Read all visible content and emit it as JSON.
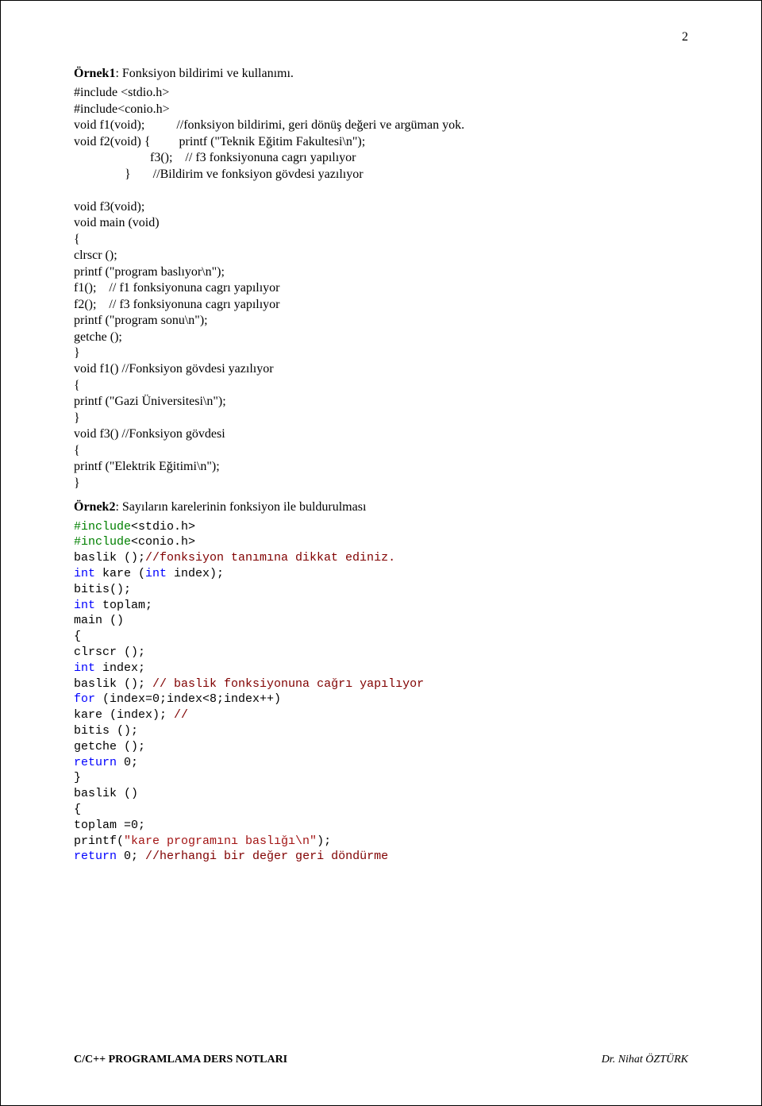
{
  "pageNumber": "2",
  "section1": {
    "title_bold": "Örnek1",
    "title_rest": ": Fonksiyon bildirimi ve kullanımı.",
    "code": "#include <stdio.h>\n#include<conio.h>\nvoid f1(void);          //fonksiyon bildirimi, geri dönüş değeri ve argüman yok.\nvoid f2(void) {         printf (\"Teknik Eğitim Fakultesi\\n\");\n                        f3();    // f3 fonksiyonuna cagrı yapılıyor\n                }       //Bildirim ve fonksiyon gövdesi yazılıyor\n\nvoid f3(void);\nvoid main (void)\n{\nclrscr ();\nprintf (\"program baslıyor\\n\");\nf1();    // f1 fonksiyonuna cagrı yapılıyor\nf2();    // f3 fonksiyonuna cagrı yapılıyor\nprintf (\"program sonu\\n\");\ngetche ();\n}\nvoid f1() //Fonksiyon gövdesi yazılıyor\n{\nprintf (\"Gazi Üniversitesi\\n\");\n}\nvoid f3() //Fonksiyon gövdesi\n{\nprintf (\"Elektrik Eğitimi\\n\");\n}"
  },
  "section2": {
    "title_bold": "Örnek2",
    "title_rest": ": Sayıların karelerinin fonksiyon ile buldurulması",
    "lines": [
      {
        "seg": [
          {
            "c": "k",
            "t": "#include"
          },
          {
            "c": "",
            "t": "<stdio.h>"
          }
        ]
      },
      {
        "seg": [
          {
            "c": "k",
            "t": "#include"
          },
          {
            "c": "",
            "t": "<conio.h>"
          }
        ]
      },
      {
        "seg": [
          {
            "c": "",
            "t": "baslik ();"
          },
          {
            "c": "c",
            "t": "//fonksiyon tanımına dikkat ediniz."
          }
        ]
      },
      {
        "seg": [
          {
            "c": "t",
            "t": "int"
          },
          {
            "c": "",
            "t": " kare ("
          },
          {
            "c": "t",
            "t": "int"
          },
          {
            "c": "",
            "t": " index);"
          }
        ]
      },
      {
        "seg": [
          {
            "c": "",
            "t": "bitis();"
          }
        ]
      },
      {
        "seg": [
          {
            "c": "t",
            "t": "int"
          },
          {
            "c": "",
            "t": " toplam;"
          }
        ]
      },
      {
        "seg": [
          {
            "c": "",
            "t": "main ()"
          }
        ]
      },
      {
        "seg": [
          {
            "c": "",
            "t": "{"
          }
        ]
      },
      {
        "seg": [
          {
            "c": "",
            "t": "clrscr ();"
          }
        ]
      },
      {
        "seg": [
          {
            "c": "t",
            "t": "int"
          },
          {
            "c": "",
            "t": " index;"
          }
        ]
      },
      {
        "seg": [
          {
            "c": "",
            "t": "baslik (); "
          },
          {
            "c": "c",
            "t": "// baslik fonksiyonuna cağrı yapılıyor"
          }
        ]
      },
      {
        "seg": [
          {
            "c": "t",
            "t": "for"
          },
          {
            "c": "",
            "t": " (index=0;index<8;index++)"
          }
        ]
      },
      {
        "seg": [
          {
            "c": "",
            "t": "kare (index); "
          },
          {
            "c": "c",
            "t": "//"
          }
        ]
      },
      {
        "seg": [
          {
            "c": "",
            "t": "bitis ();"
          }
        ]
      },
      {
        "seg": [
          {
            "c": "",
            "t": "getche ();"
          }
        ]
      },
      {
        "seg": [
          {
            "c": "t",
            "t": "return"
          },
          {
            "c": "",
            "t": " 0;"
          }
        ]
      },
      {
        "seg": [
          {
            "c": "",
            "t": "}"
          }
        ]
      },
      {
        "seg": [
          {
            "c": "",
            "t": "baslik ()"
          }
        ]
      },
      {
        "seg": [
          {
            "c": "",
            "t": "{"
          }
        ]
      },
      {
        "seg": [
          {
            "c": "",
            "t": "toplam =0;"
          }
        ]
      },
      {
        "seg": [
          {
            "c": "",
            "t": "printf("
          },
          {
            "c": "s",
            "t": "\"kare programını baslığı\\n\""
          },
          {
            "c": "",
            "t": ");"
          }
        ]
      },
      {
        "seg": [
          {
            "c": "t",
            "t": "return"
          },
          {
            "c": "",
            "t": " 0; "
          },
          {
            "c": "c",
            "t": "//herhangi bir değer geri döndürme"
          }
        ]
      }
    ]
  },
  "footer": {
    "title": "C/C++ PROGRAMLAMA DERS NOTLARI",
    "author": "Dr. Nihat ÖZTÜRK"
  }
}
